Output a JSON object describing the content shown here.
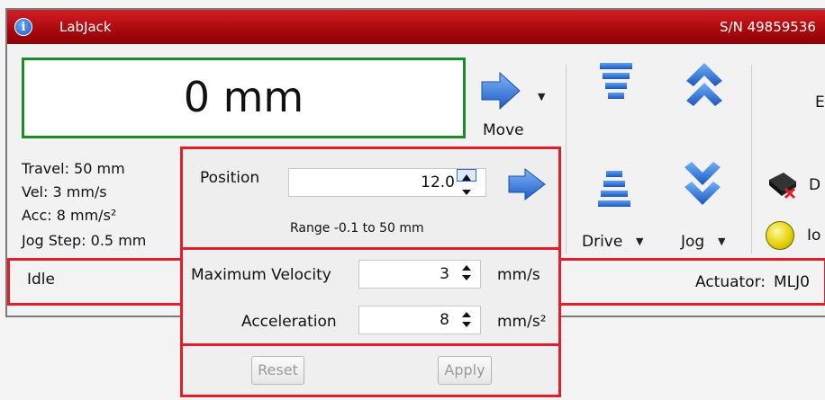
{
  "titlebar": {
    "title": "LabJack",
    "serial": "S/N 49859536"
  },
  "display": {
    "position_text": "0 mm"
  },
  "controls": {
    "move_label": "Move",
    "drive_label": "Drive",
    "jog_label": "Jog",
    "right_partial_1": "E",
    "right_partial_2": "D",
    "right_partial_3": "Io"
  },
  "info": {
    "travel": "Travel: 50 mm",
    "vel": "Vel: 3 mm/s",
    "acc": "Acc: 8 mm/s²",
    "jog_step": "Jog Step: 0.5 mm"
  },
  "position_panel": {
    "label": "Position",
    "value": "12.0",
    "range_text": "Range -0.1 to 50 mm"
  },
  "status": {
    "state": "Idle",
    "actuator_label": "Actuator:",
    "actuator_value": "MLJ0"
  },
  "settings": {
    "max_velocity_label": "Maximum Velocity",
    "max_velocity_value": "3",
    "max_velocity_unit": "mm/s",
    "acceleration_label": "Acceleration",
    "acceleration_value": "8",
    "acceleration_unit": "mm/s²"
  },
  "buttons": {
    "reset": "Reset",
    "apply": "Apply"
  },
  "colors": {
    "titlebar": "#b01015",
    "highlight": "#e01f2b",
    "display_border": "#1d8a2a",
    "arrow_blue": "#2f6fd6"
  }
}
